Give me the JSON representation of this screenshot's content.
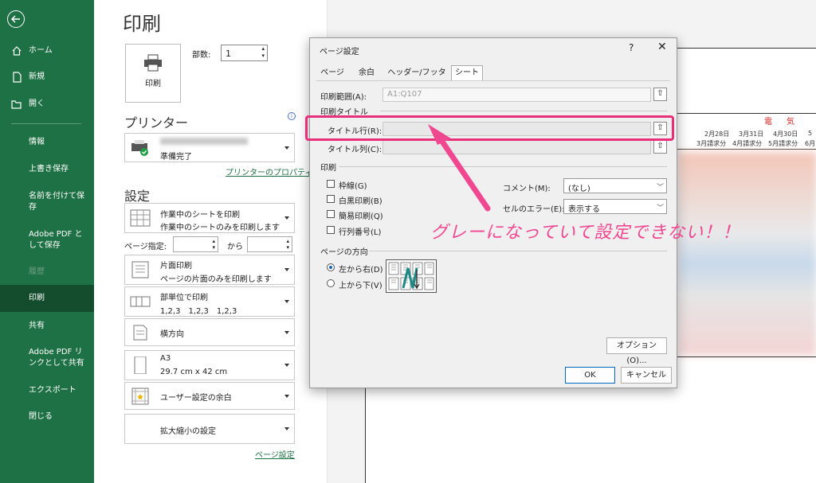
{
  "sidebar": {
    "items": [
      {
        "label": "ホーム",
        "icon": "home-icon"
      },
      {
        "label": "新規",
        "icon": "new-document-icon"
      },
      {
        "label": "開く",
        "icon": "folder-open-icon"
      },
      {
        "label": "情報"
      },
      {
        "label": "上書き保存"
      },
      {
        "label": "名前を付けて保存"
      },
      {
        "label": "Adobe PDF として保存"
      },
      {
        "label": "履歴"
      },
      {
        "label": "印刷"
      },
      {
        "label": "共有"
      },
      {
        "label": "Adobe PDF リンクとして共有"
      },
      {
        "label": "エクスポート"
      },
      {
        "label": "閉じる"
      }
    ]
  },
  "print": {
    "title": "印刷",
    "print_button": "印刷",
    "copies_label": "部数:",
    "copies_value": "1",
    "printer_heading": "プリンター",
    "printer_status": "準備完了",
    "printer_properties": "プリンターのプロパティ",
    "settings_heading": "設定",
    "what_to_print": {
      "line1": "作業中のシートを印刷",
      "line2": "作業中のシートのみを印刷します"
    },
    "pages_label": "ページ指定:",
    "pages_to": "から",
    "sides": {
      "line1": "片面印刷",
      "line2": "ページの片面のみを印刷します"
    },
    "collate": {
      "line1": "部単位で印刷",
      "line2": "1,2,3　1,2,3　1,2,3"
    },
    "orientation": "横方向",
    "paper": {
      "line1": "A3",
      "line2": "29.7 cm x 42 cm"
    },
    "margins": "ユーザー設定の余白",
    "scaling": "拡大縮小の設定",
    "page_setup_link": "ページ設定"
  },
  "preview": {
    "header_cells": [
      "2月28日",
      "3月31日",
      "4月30日",
      "5",
      "3月請求分",
      "4月請求分",
      "5月請求分",
      "6月"
    ],
    "red_chars": [
      "電",
      "気"
    ]
  },
  "dialog": {
    "title": "ページ設定",
    "help": "?",
    "close": "✕",
    "tabs": [
      "ページ",
      "余白",
      "ヘッダー/フッター",
      "シート"
    ],
    "print_area_label": "印刷範囲(A):",
    "print_area_value": "A1:Q107",
    "print_titles_label": "印刷タイトル",
    "title_rows_label": "タイトル行(R):",
    "title_cols_label": "タイトル列(C):",
    "print_group": "印刷",
    "checkboxes": [
      "枠線(G)",
      "白黒印刷(B)",
      "簡易印刷(Q)",
      "行列番号(L)"
    ],
    "comments_label": "コメント(M):",
    "comments_value": "(なし)",
    "cell_errors_label": "セルのエラー(E):",
    "cell_errors_value": "表示する",
    "page_order_label": "ページの方向",
    "page_order_options": [
      "左から右(D)",
      "上から下(V)"
    ],
    "options_button": "オプション(O)...",
    "ok": "OK",
    "cancel": "キャンセル"
  },
  "annotation": "グレーになっていて設定できない！！",
  "colors": {
    "excel_green": "#1e7145",
    "highlight_pink": "#e8307a",
    "annotation_pink": "#f04890"
  }
}
